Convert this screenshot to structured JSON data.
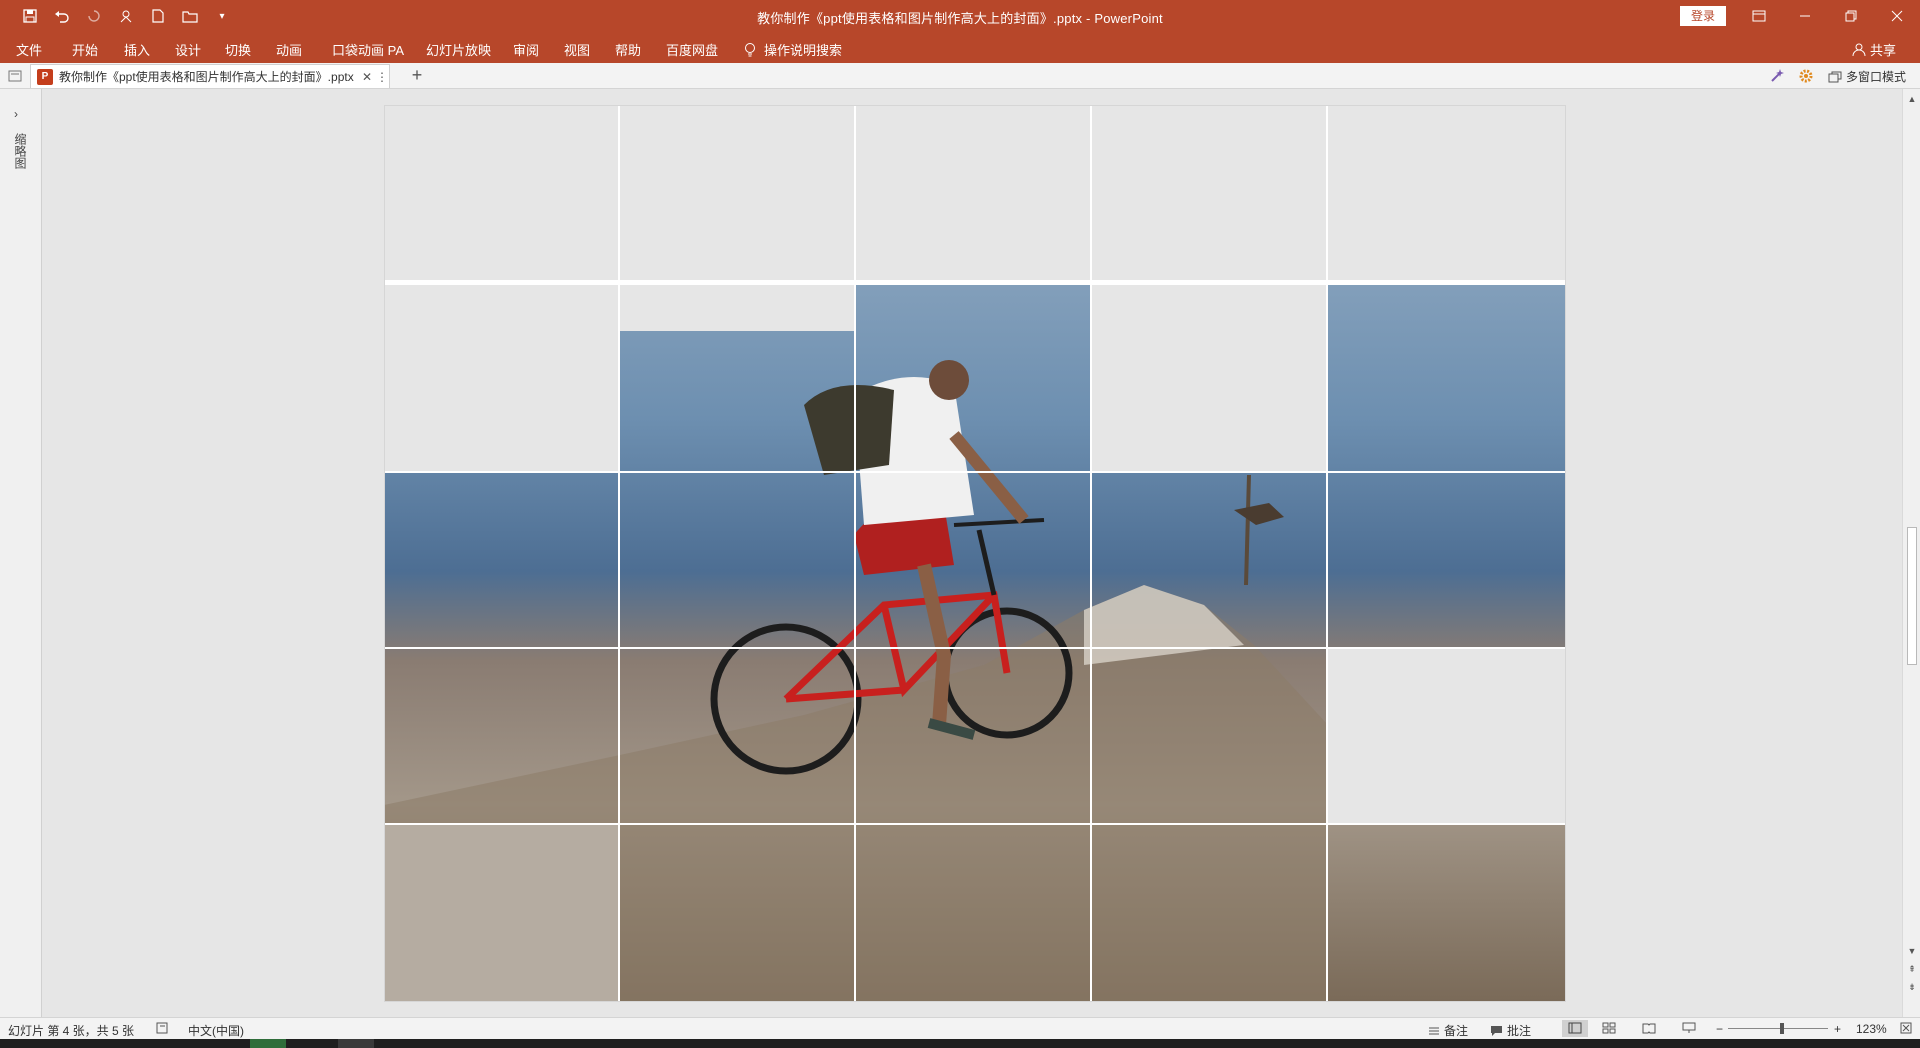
{
  "window": {
    "title": "教你制作《ppt使用表格和图片制作高大上的封面》.pptx  -  PowerPoint",
    "login_label": "登录",
    "accent_color": "#b7472a"
  },
  "quick_access": [
    "save-icon",
    "undo-icon",
    "redo-icon",
    "touch-mode-icon",
    "new-file-icon",
    "open-folder-icon",
    "customize-icon"
  ],
  "ribbon": {
    "tabs": [
      "文件",
      "开始",
      "插入",
      "设计",
      "切换",
      "动画",
      "口袋动画 PA",
      "幻灯片放映",
      "审阅",
      "视图",
      "帮助",
      "百度网盘"
    ],
    "tell_me": "操作说明搜索",
    "share_label": "共享"
  },
  "doc_tabs": {
    "active_tab": "教你制作《ppt使用表格和图片制作高大上的封面》.pptx",
    "multi_window_label": "多窗口模式"
  },
  "thumbnail_rail": {
    "label": "缩略图"
  },
  "status_bar": {
    "slide_info": "幻灯片 第 4 张，共 5 张",
    "language": "中文(中国)",
    "notes_label": "备注",
    "comments_label": "批注",
    "zoom_level": "123%"
  }
}
